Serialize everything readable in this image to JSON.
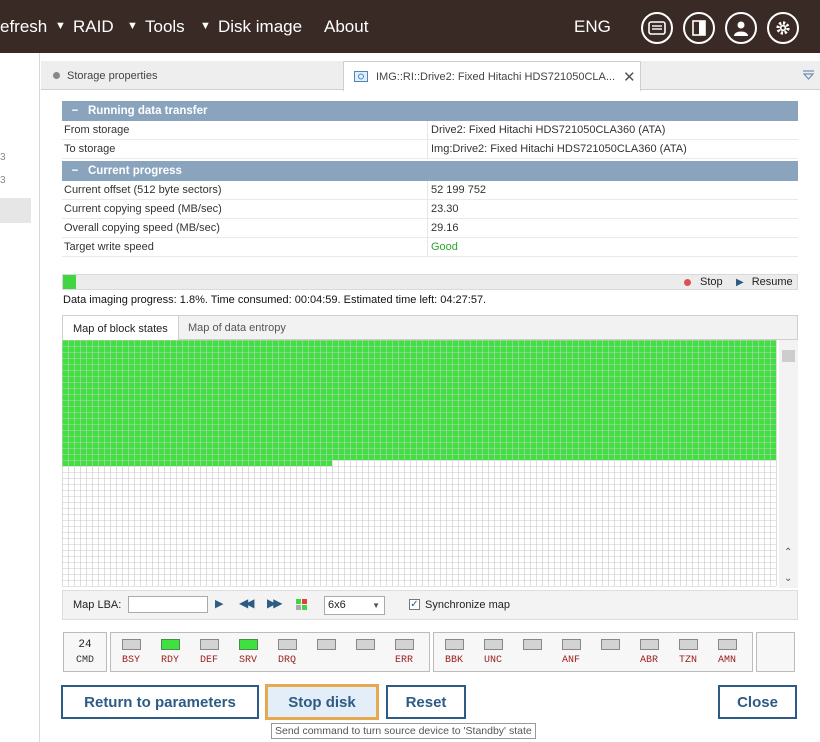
{
  "menu": {
    "refresh": "efresh",
    "raid": "RAID",
    "tools": "Tools",
    "disk_image": "Disk image",
    "about": "About",
    "lang": "ENG"
  },
  "left": {
    "item1": "3",
    "item2": "3"
  },
  "tabs": {
    "storage_properties": "Storage properties",
    "image_tab": "IMG::RI::Drive2: Fixed Hitachi HDS721050CLA..."
  },
  "transfer": {
    "title": "Running data transfer",
    "from_label": "From storage",
    "from_value": "Drive2: Fixed Hitachi HDS721050CLA360 (ATA)",
    "to_label": "To storage",
    "to_value": "Img:Drive2: Fixed Hitachi HDS721050CLA360 (ATA)"
  },
  "progress": {
    "title": "Current progress",
    "offset_label": "Current offset (512 byte sectors)",
    "offset_value": "52 199 752",
    "cur_speed_label": "Current copying speed (MB/sec)",
    "cur_speed_value": "23.30",
    "overall_speed_label": "Overall copying speed (MB/sec)",
    "overall_speed_value": "29.16",
    "write_speed_label": "Target write speed",
    "write_speed_value": "Good",
    "fraction": 0.018,
    "stop_label": "Stop",
    "resume_label": "Resume",
    "status_text": "Data imaging progress: 1.8%. Time consumed: 00:04:59. Estimated time left: 04:27:57."
  },
  "map": {
    "tab_block_states": "Map of block states",
    "tab_data_entropy": "Map of data entropy",
    "lba_label": "Map LBA:",
    "lba_value": "",
    "block_size": "6x6",
    "sync_label": "Synchronize map"
  },
  "registers": {
    "cmd_value": "24",
    "cmd_label": "CMD",
    "status": [
      {
        "name": "BSY",
        "on": false
      },
      {
        "name": "RDY",
        "on": true
      },
      {
        "name": "DEF",
        "on": false
      },
      {
        "name": "SRV",
        "on": true
      },
      {
        "name": "DRQ",
        "on": false
      },
      {
        "name": "",
        "on": false
      },
      {
        "name": "",
        "on": false
      },
      {
        "name": "ERR",
        "on": false
      }
    ],
    "error": [
      {
        "name": "BBK",
        "on": false
      },
      {
        "name": "UNC",
        "on": false
      },
      {
        "name": "",
        "on": false
      },
      {
        "name": "ANF",
        "on": false
      },
      {
        "name": "",
        "on": false
      },
      {
        "name": "ABR",
        "on": false
      },
      {
        "name": "TZN",
        "on": false
      },
      {
        "name": "AMN",
        "on": false
      }
    ]
  },
  "buttons": {
    "return": "Return to parameters",
    "stop_disk": "Stop disk",
    "reset": "Reset",
    "close": "Close"
  },
  "tooltip": "Send command to turn source device to 'Standby' state",
  "colors": {
    "topbar": "#3a2a26",
    "section_header": "#8aa4bd",
    "good": "#2aa52a",
    "block_done": "#41e041",
    "button_text": "#2d5b86"
  },
  "icons": [
    "messages-icon",
    "panel-icon",
    "user-icon",
    "gear-icon",
    "stop-dot-icon",
    "play-icon",
    "chevron-down-icon",
    "close-icon"
  ]
}
